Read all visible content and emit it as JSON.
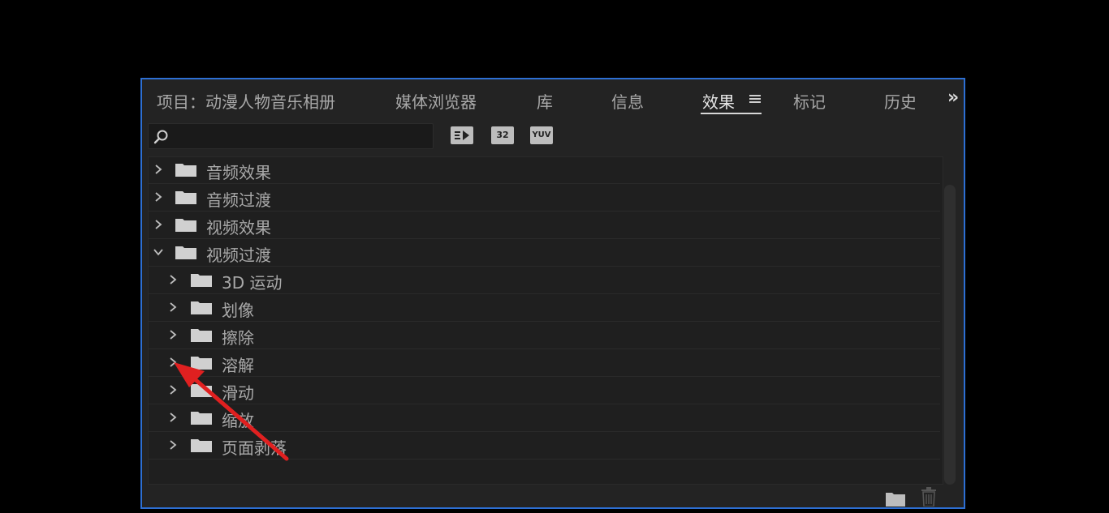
{
  "tabs": [
    {
      "label": "项目：动漫人物音乐相册",
      "active": false
    },
    {
      "label": "媒体浏览器",
      "active": false
    },
    {
      "label": "库",
      "active": false
    },
    {
      "label": "信息",
      "active": false
    },
    {
      "label": "效果",
      "active": true
    },
    {
      "label": "标记",
      "active": false
    },
    {
      "label": "历史",
      "active": false
    }
  ],
  "toolbar": {
    "search_placeholder": "",
    "search_value": "",
    "badges": [
      "32",
      "YUV"
    ]
  },
  "tree": {
    "items": [
      {
        "label": "音频效果",
        "level": 0,
        "expanded": false
      },
      {
        "label": "音频过渡",
        "level": 0,
        "expanded": false
      },
      {
        "label": "视频效果",
        "level": 0,
        "expanded": false
      },
      {
        "label": "视频过渡",
        "level": 0,
        "expanded": true
      },
      {
        "label": "3D 运动",
        "level": 1,
        "expanded": false
      },
      {
        "label": "划像",
        "level": 1,
        "expanded": false
      },
      {
        "label": "擦除",
        "level": 1,
        "expanded": false
      },
      {
        "label": "溶解",
        "level": 1,
        "expanded": false
      },
      {
        "label": "滑动",
        "level": 1,
        "expanded": false
      },
      {
        "label": "缩放",
        "level": 1,
        "expanded": false
      },
      {
        "label": "页面剥落",
        "level": 1,
        "expanded": false
      }
    ]
  },
  "icons": {
    "search": "search-icon",
    "accelerated": "accelerated-effects-icon",
    "bit32": "32bit-color-icon",
    "yuv": "yuv-effects-icon",
    "new_folder": "new-folder-icon",
    "delete": "trash-icon",
    "overflow": "chevrons-right-icon",
    "menu": "hamburger-menu-icon"
  },
  "colors": {
    "panel_bg": "#232323",
    "focus_border": "#2d6fd3",
    "annotation_arrow": "#e02020"
  }
}
